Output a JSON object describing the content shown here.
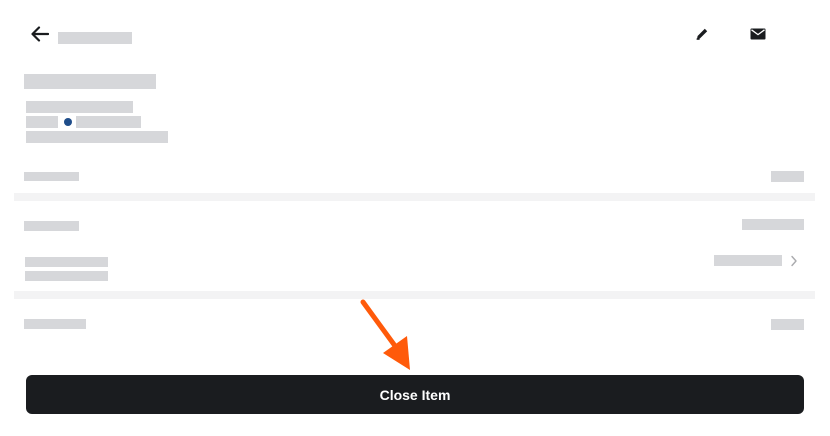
{
  "header": {
    "back_icon": "arrow-left-icon",
    "edit_icon": "pencil-icon",
    "email_icon": "envelope-icon"
  },
  "actions": {
    "close_label": "Close Item"
  },
  "annotation": {
    "arrow_color": "#ff5a0a"
  },
  "colors": {
    "button_background": "#1a1c1f",
    "placeholder": "#d6d7da",
    "status_dot": "#1f4d8a"
  }
}
